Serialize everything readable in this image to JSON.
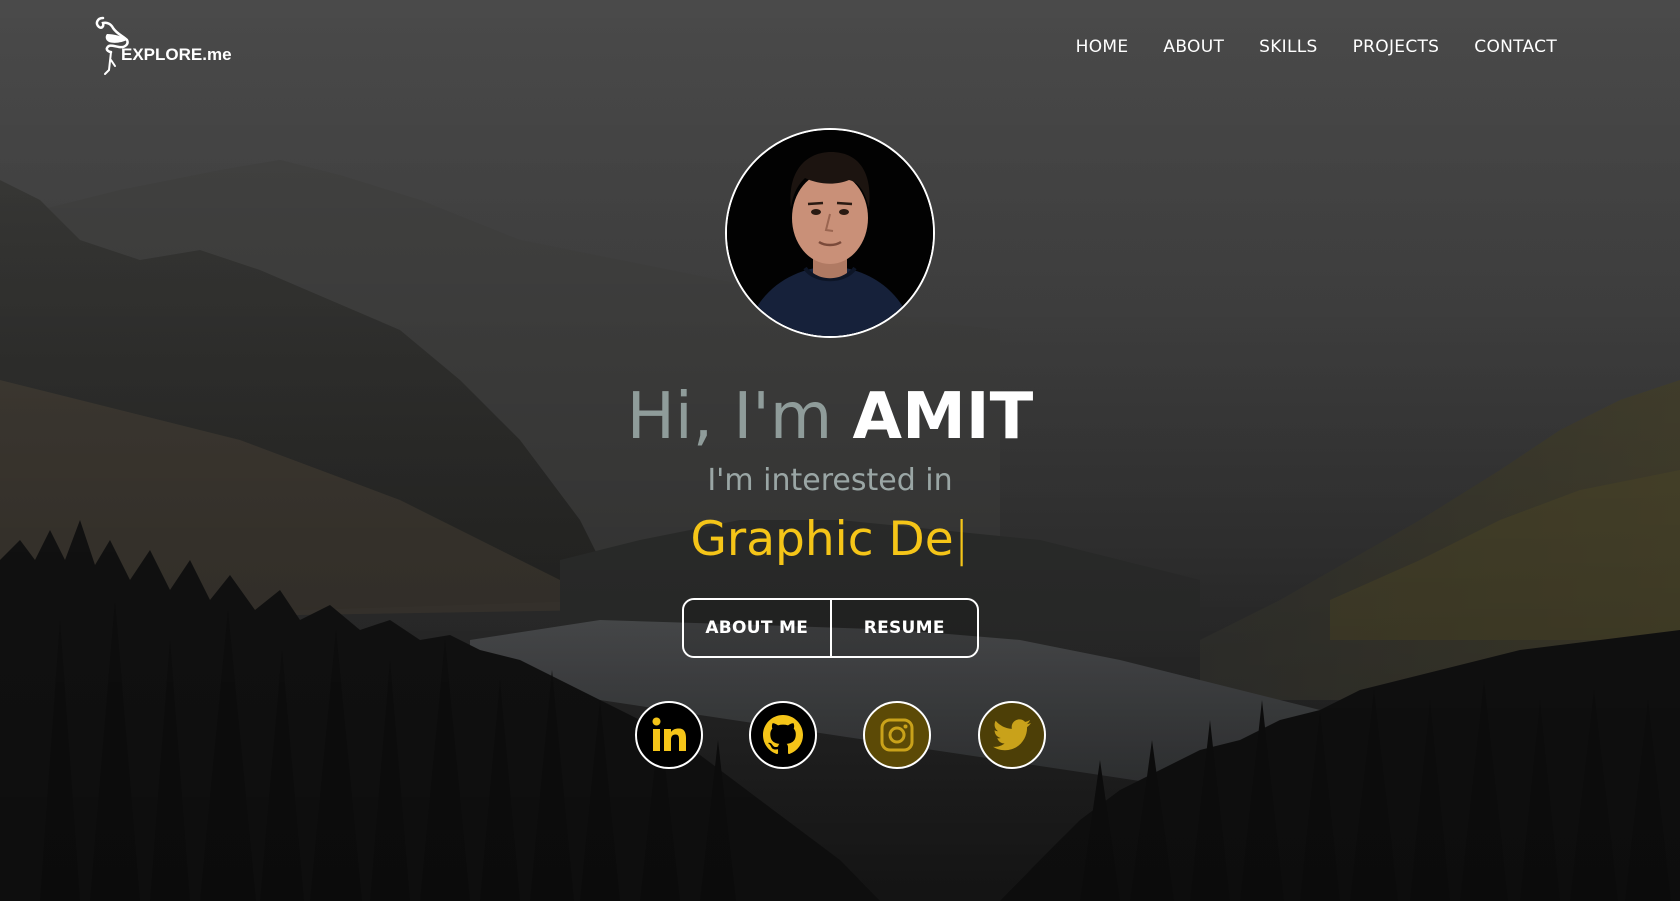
{
  "brand": {
    "logo_text": "EXPLORE.me"
  },
  "nav": {
    "items": [
      {
        "label": "HOME"
      },
      {
        "label": "ABOUT"
      },
      {
        "label": "SKILLS"
      },
      {
        "label": "PROJECTS"
      },
      {
        "label": "CONTACT"
      }
    ]
  },
  "hero": {
    "greeting": "Hi, I'm",
    "name": "AMIT",
    "interest_label": "I'm interested in",
    "typed_text": "Graphic De",
    "cursor": "|",
    "accent_color": "#f5c518",
    "buttons": {
      "about_label": "ABOUT ME",
      "resume_label": "RESUME"
    }
  },
  "social": [
    {
      "icon": "linkedin-icon"
    },
    {
      "icon": "github-icon"
    },
    {
      "icon": "instagram-icon"
    },
    {
      "icon": "twitter-icon"
    }
  ]
}
